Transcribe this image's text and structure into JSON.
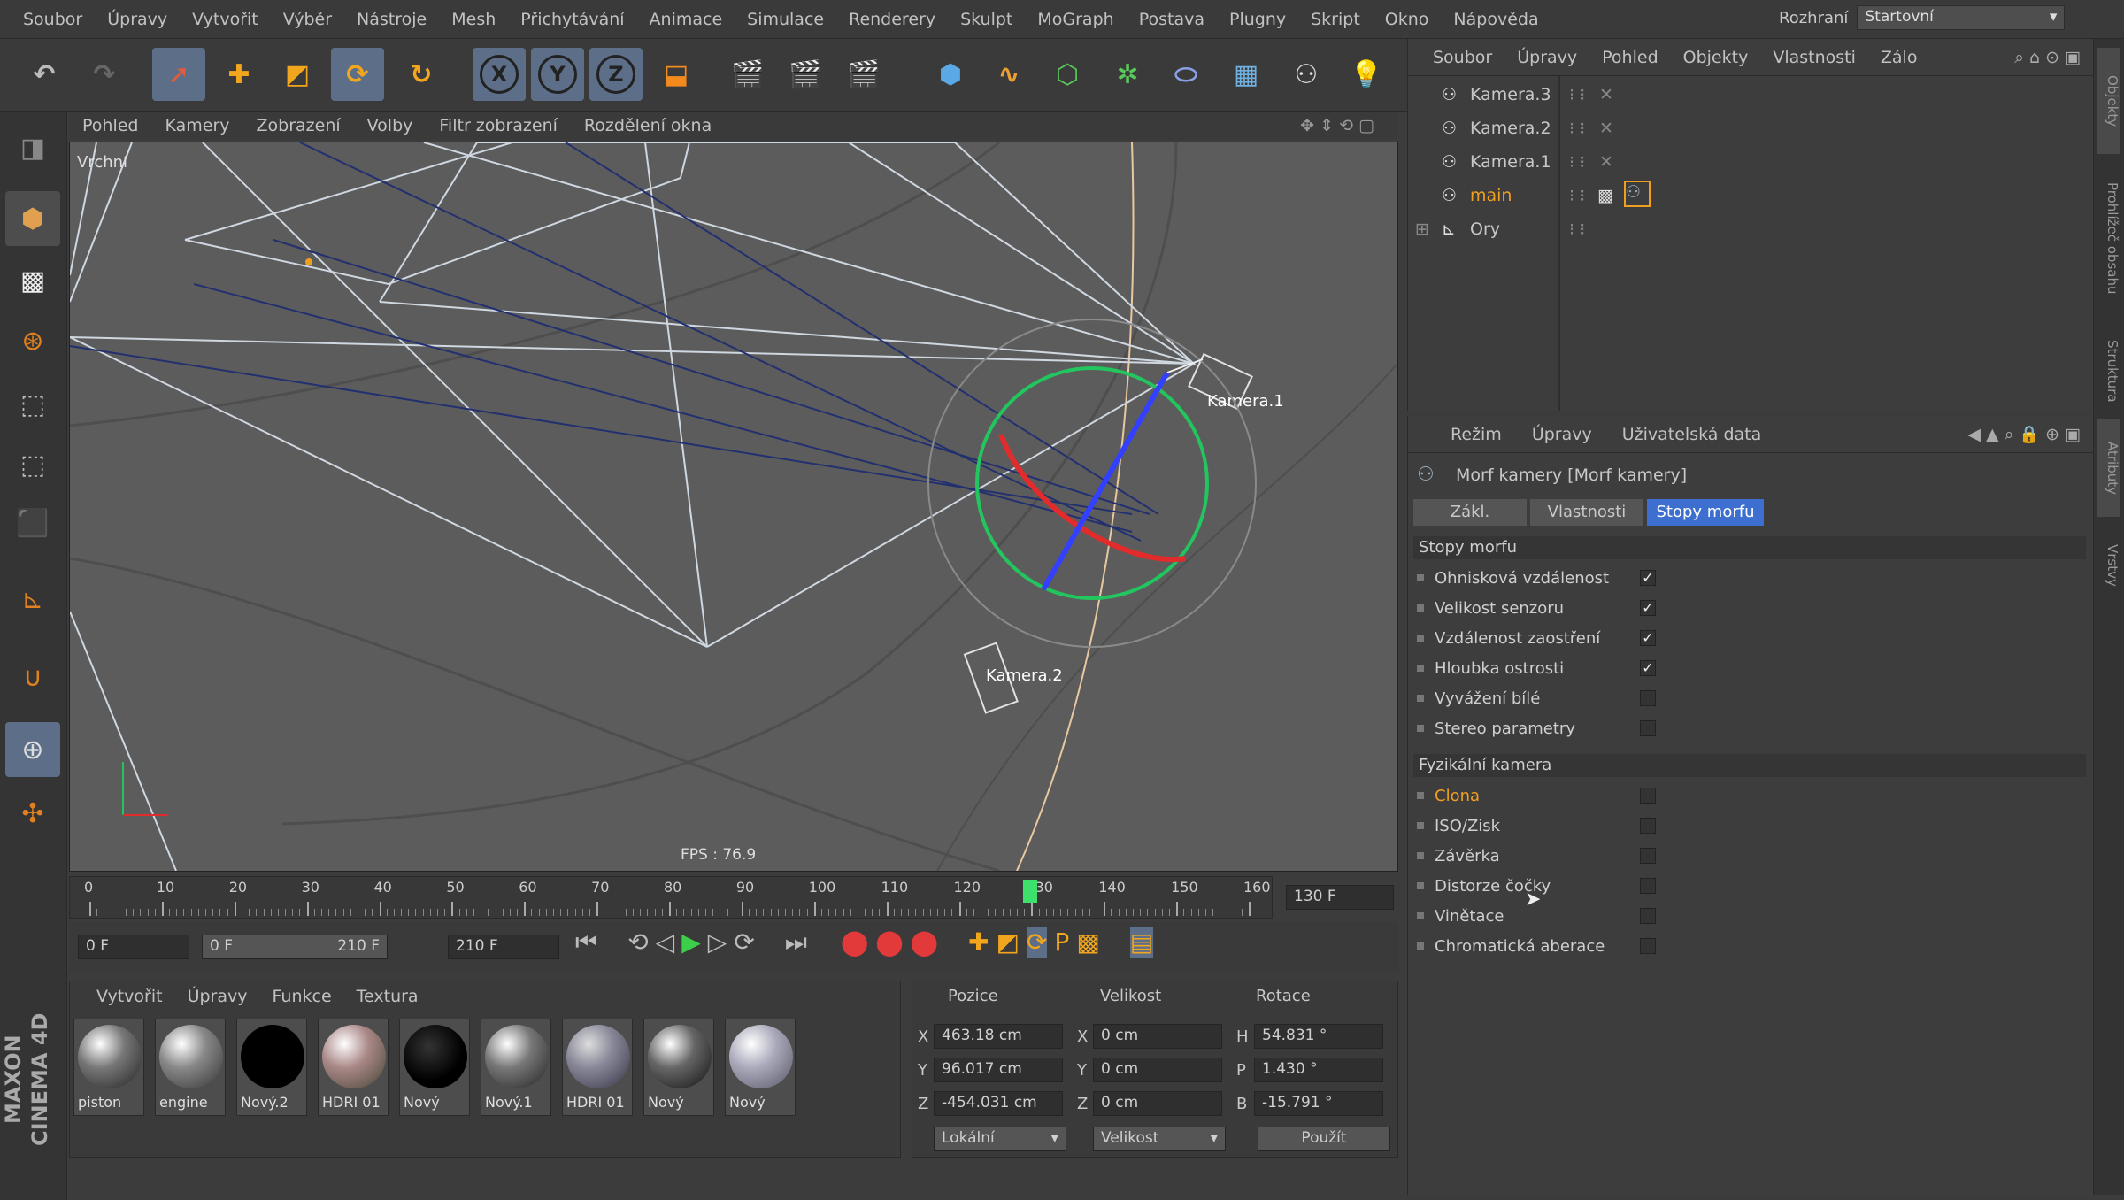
{
  "menubar": {
    "items": [
      "Soubor",
      "Úpravy",
      "Vytvořit",
      "Výběr",
      "Nástroje",
      "Mesh",
      "Přichytávání",
      "Animace",
      "Simulace",
      "Renderery",
      "Skulpt",
      "MoGraph",
      "Postava",
      "Plugny",
      "Skript",
      "Okno",
      "Nápověda"
    ],
    "layout_label": "Rozhraní",
    "layout_value": "Startovní"
  },
  "toolbar": {
    "axis_x": "X",
    "axis_y": "Y",
    "axis_z": "Z"
  },
  "viewport": {
    "menu": [
      "Pohled",
      "Kamery",
      "Zobrazení",
      "Volby",
      "Filtr zobrazení",
      "Rozdělení okna"
    ],
    "view_name": "Vrchní",
    "fps": "FPS : 76.9",
    "camera_labels": {
      "kamera1": "Kamera.1",
      "kamera2": "Kamera.2"
    }
  },
  "timeline": {
    "ticks": [
      "0",
      "10",
      "20",
      "30",
      "40",
      "50",
      "60",
      "70",
      "80",
      "90",
      "100",
      "110",
      "120",
      "130",
      "140",
      "150",
      "160"
    ],
    "current_frame_fraction": 0.8125,
    "end_field": "130 F"
  },
  "transport": {
    "start_field": "0 F",
    "range_start": "0 F",
    "range_end": "210 F",
    "end_field": "210 F"
  },
  "materials": {
    "menu": [
      "Vytvořit",
      "Úpravy",
      "Funkce",
      "Textura"
    ],
    "items": [
      {
        "name": "piston"
      },
      {
        "name": "engine"
      },
      {
        "name": "Nový.2"
      },
      {
        "name": "HDRI 01"
      },
      {
        "name": "Nový"
      },
      {
        "name": "Nový.1"
      },
      {
        "name": "HDRI 01"
      },
      {
        "name": "Nový"
      },
      {
        "name": "Nový"
      }
    ]
  },
  "coords": {
    "headers": {
      "pos": "Pozice",
      "size": "Velikost",
      "rot": "Rotace"
    },
    "pos": {
      "x_label": "X",
      "x": "463.18 cm",
      "y_label": "Y",
      "y": "96.017 cm",
      "z_label": "Z",
      "z": "-454.031 cm"
    },
    "size": {
      "x_label": "X",
      "x": "0 cm",
      "y_label": "Y",
      "y": "0 cm",
      "z_label": "Z",
      "z": "0 cm"
    },
    "rot": {
      "h_label": "H",
      "h": "54.831 °",
      "p_label": "P",
      "p": "1.430 °",
      "b_label": "B",
      "b": "-15.791 °"
    },
    "mode": "Lokální",
    "size_mode": "Velikost",
    "apply": "Použít"
  },
  "objmgr": {
    "menu": [
      "Soubor",
      "Úpravy",
      "Pohled",
      "Objekty",
      "Vlastnosti",
      "Zálo"
    ],
    "objects": [
      {
        "name": "Kamera.3"
      },
      {
        "name": "Kamera.2"
      },
      {
        "name": "Kamera.1"
      },
      {
        "name": "main"
      },
      {
        "name": "Ory"
      }
    ]
  },
  "attrmgr": {
    "menu": [
      "Režim",
      "Úpravy",
      "Uživatelská data"
    ],
    "title": "Morf kamery [Morf kamery]",
    "tabs": [
      "Zákl.",
      "Vlastnosti",
      "Stopy morfu"
    ],
    "section1": "Stopy morfu",
    "tracks": [
      {
        "label": "Ohnisková vzdálenost",
        "checked": true
      },
      {
        "label": "Velikost senzoru",
        "checked": true
      },
      {
        "label": "Vzdálenost zaostření",
        "checked": true
      },
      {
        "label": "Hloubka ostrosti",
        "checked": true
      },
      {
        "label": "Vyvážení bílé",
        "checked": false
      },
      {
        "label": "Stereo parametry",
        "checked": false
      }
    ],
    "section2": "Fyzikální kamera",
    "physical": [
      {
        "label": "Clona",
        "checked": false
      },
      {
        "label": "ISO/Zisk",
        "checked": false
      },
      {
        "label": "Závěrka",
        "checked": false
      },
      {
        "label": "Distorze čočky",
        "checked": false
      },
      {
        "label": "Vinětace",
        "checked": false
      },
      {
        "label": "Chromatická aberace",
        "checked": false
      }
    ],
    "check_mark": "✓"
  },
  "sidebar": {
    "tabs": [
      "Objekty",
      "Prohlížeč obsahu",
      "Struktura",
      "Atributy",
      "Vrstvy"
    ]
  },
  "brand": "MAXON CINEMA 4D",
  "colors": {
    "accent": "#5d6f88",
    "highlight": "#f0a020",
    "tab_active": "#3d6fd1"
  }
}
